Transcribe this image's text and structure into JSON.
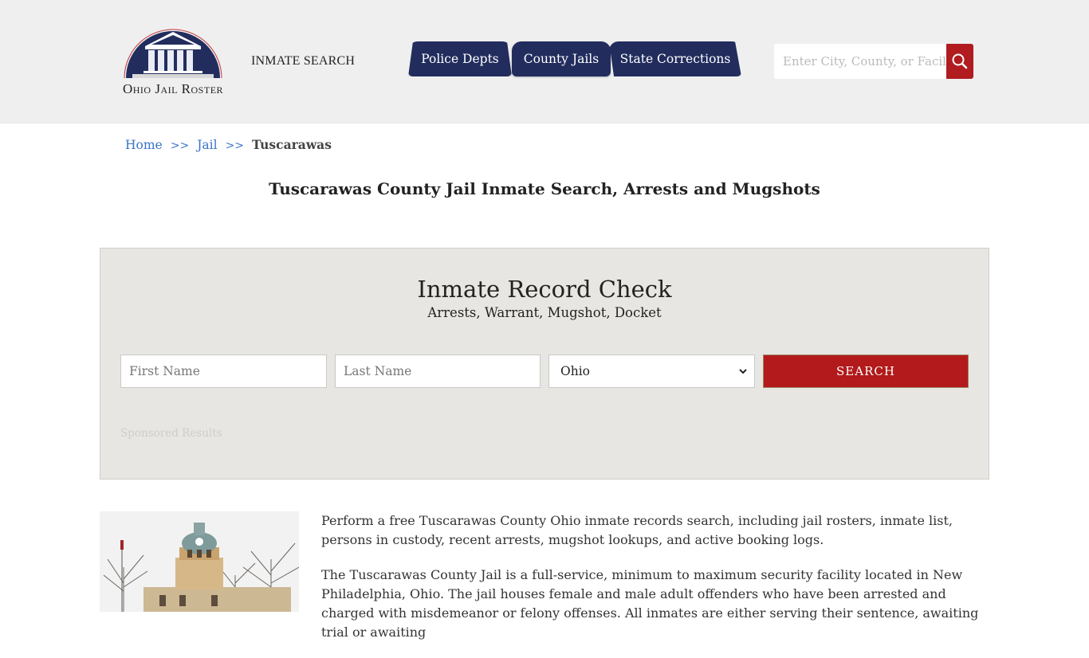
{
  "header": {
    "logo_text": "Ohio Jail Roster",
    "brand_label": "INMATE SEARCH",
    "nav": [
      {
        "label": "Police Depts"
      },
      {
        "label": "County Jails"
      },
      {
        "label": "State Corrections"
      }
    ],
    "search": {
      "placeholder": "Enter City, County, or Facility",
      "button_icon": "search-icon"
    }
  },
  "breadcrumb": {
    "items": [
      {
        "label": "Home"
      },
      {
        "label": "Jail"
      }
    ],
    "separator": ">>",
    "current": "Tuscarawas"
  },
  "page_title": "Tuscarawas County Jail Inmate Search, Arrests and Mugshots",
  "record_check": {
    "title": "Inmate Record Check",
    "subtitle": "Arrests, Warrant, Mugshot, Docket",
    "first_name_placeholder": "First Name",
    "last_name_placeholder": "Last Name",
    "state_selected": "Ohio",
    "search_label": "SEARCH",
    "sponsored_label": "Sponsored Results"
  },
  "content": {
    "image_alt": "Tuscarawas County Courthouse",
    "paragraphs": [
      "Perform a free Tuscarawas County Ohio inmate records search, including jail rosters, inmate list, persons in custody, recent arrests, mugshot lookups, and active booking logs.",
      "The Tuscarawas County Jail is a full-service, minimum to maximum security facility located in New Philadelphia, Ohio. The jail houses female and male adult offenders who have been arrested and charged with misdemeanor or felony offenses. All inmates are either serving their sentence, awaiting trial or awaiting"
    ]
  },
  "colors": {
    "header_bg": "#efefef",
    "nav_bg": "#222d5e",
    "accent_red": "#b21a1b",
    "link_blue": "#3a74c9",
    "panel_bg": "#e8e6e2"
  }
}
